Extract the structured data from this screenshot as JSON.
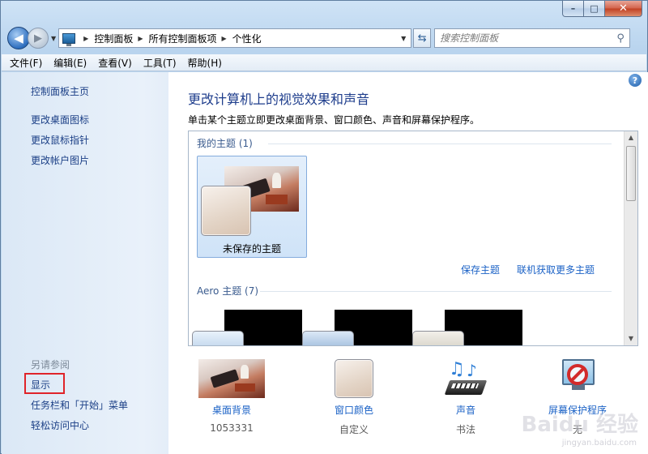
{
  "window": {
    "caption_min": "–",
    "caption_max": "□",
    "caption_close": "✕"
  },
  "nav": {
    "back": "◀",
    "forward": "▶"
  },
  "address": {
    "crumbs": [
      "控制面板",
      "所有控制面板项",
      "个性化"
    ]
  },
  "search": {
    "placeholder": "搜索控制面板"
  },
  "menu": [
    "文件(F)",
    "编辑(E)",
    "查看(V)",
    "工具(T)",
    "帮助(H)"
  ],
  "sidebar": {
    "links": [
      "控制面板主页",
      "更改桌面图标",
      "更改鼠标指针",
      "更改帐户图片"
    ],
    "see_also_title": "另请参阅",
    "see_also": [
      "显示",
      "任务栏和「开始」菜单",
      "轻松访问中心"
    ]
  },
  "main": {
    "heading": "更改计算机上的视觉效果和声音",
    "subtext": "单击某个主题立即更改桌面背景、窗口颜色、声音和屏幕保护程序。",
    "my_themes_label": "我的主题 (1)",
    "unsaved_theme": "未保存的主题",
    "save_theme": "保存主题",
    "more_themes": "联机获取更多主题",
    "aero_label": "Aero 主题 (7)"
  },
  "bottom": [
    {
      "label": "桌面背景",
      "sub": "1053331",
      "icon": "desktop-background-icon"
    },
    {
      "label": "窗口颜色",
      "sub": "自定义",
      "icon": "window-color-icon"
    },
    {
      "label": "声音",
      "sub": "书法",
      "icon": "sound-icon"
    },
    {
      "label": "屏幕保护程序",
      "sub": "无",
      "icon": "screensaver-icon"
    }
  ],
  "watermark": {
    "brand": "Baidu 经验",
    "url": "jingyan.baidu.com"
  },
  "colors": {
    "link": "#1b62c6",
    "heading": "#1e3d8c",
    "highlight": "#e0242a"
  }
}
